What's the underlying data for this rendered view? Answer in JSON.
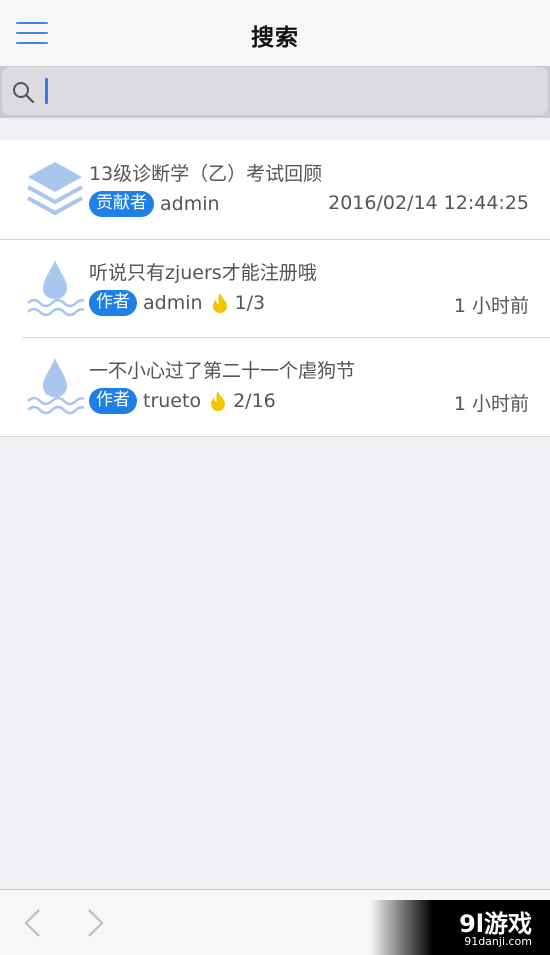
{
  "navbar": {
    "title": "搜索",
    "menu_icon": "hamburger-menu-icon"
  },
  "search": {
    "value": "",
    "placeholder": "",
    "icon": "search-icon"
  },
  "results": [
    {
      "icon": "stack-layers-icon",
      "title": "13级诊断学（乙）考试回顾",
      "badge": "贡献者",
      "user": "admin",
      "count": "",
      "time": "2016/02/14 12:44:25"
    },
    {
      "icon": "water-drop-icon",
      "title": "听说只有zjuers才能注册哦",
      "badge": "作者",
      "user": "admin",
      "count": "1/3",
      "time": "1 小时前"
    },
    {
      "icon": "water-drop-icon",
      "title": "一不小心过了第二十一个虐狗节",
      "badge": "作者",
      "user": "trueto",
      "count": "2/16",
      "time": "1 小时前"
    }
  ],
  "bottom": {
    "prev_icon": "chevron-left-icon",
    "next_icon": "chevron-right-icon"
  },
  "watermark": {
    "main": "9l游戏",
    "sub": "91danji.com"
  },
  "colors": {
    "accent": "#3b8ae6",
    "badge": "#1e7fe6",
    "icon_light": "#a9c6ee",
    "fire": "#f5c400"
  }
}
